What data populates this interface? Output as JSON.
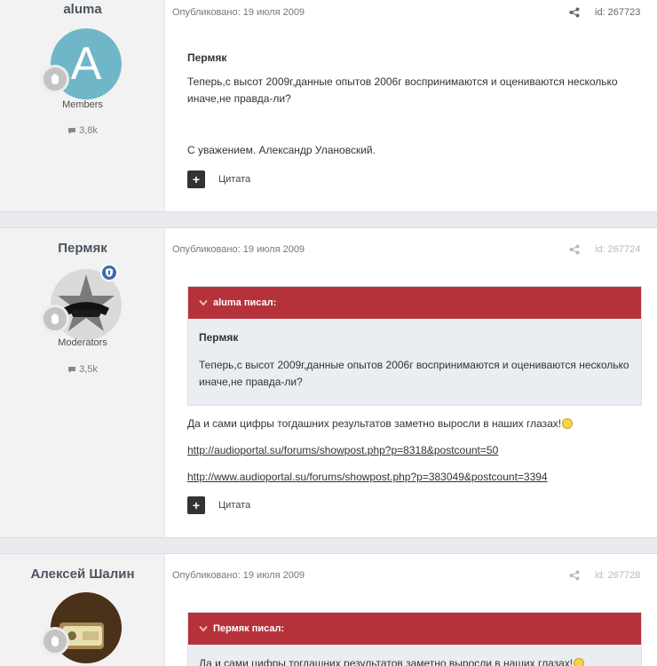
{
  "posts": [
    {
      "author": "aluma",
      "avatar_letter": "A",
      "group": "Members",
      "count": "3,8k",
      "date": "Опубликовано: 19 июля 2009",
      "id": "id: 267723",
      "lines": [
        "Пермяк",
        "Теперь,с высот 2009г,данные опытов 2006г воспринимаются и оцениваются несколько иначе,не правда-ли?",
        "С уважением. Александр Улановский."
      ],
      "quote_label": "Цитата"
    },
    {
      "author": "Пермяк",
      "group": "Moderators",
      "count": "3,5k",
      "date": "Опубликовано: 19 июля 2009",
      "id": "id: 267724",
      "quote_author": "aluma писал:",
      "quote_title": "Пермяк",
      "quote_text": "Теперь,с высот 2009г,данные опытов 2006г воспринимаются и оцениваются несколько иначе,не правда-ли?",
      "text": "Да и сами цифры тогдашних результатов заметно выросли в наших глазах!",
      "link1": "http://audioportal.su/forums/showpost.php?p=8318&postcount=50",
      "link2": "http://www.audioportal.su/forums/showpost.php?p=383049&postcount=3394",
      "quote_label": "Цитата"
    },
    {
      "author": "Алексей Шалин",
      "date": "Опубликовано: 19 июля 2009",
      "id": "id: 267728",
      "quote_author": "Пермяк писал:",
      "quote_text": "Да и сами цифры тогдашних результатов заметно выросли в наших глазах!"
    }
  ],
  "colors": {
    "quote_header": "#b6323b",
    "avatar_bg": "#6fb7c8",
    "mod_badge": "#3e6ba8"
  },
  "icons": [
    "share-icon",
    "comment-icon",
    "plus-icon",
    "chevron-down-icon",
    "smile-icon",
    "rank-hand-icon",
    "moderator-shield-icon"
  ]
}
